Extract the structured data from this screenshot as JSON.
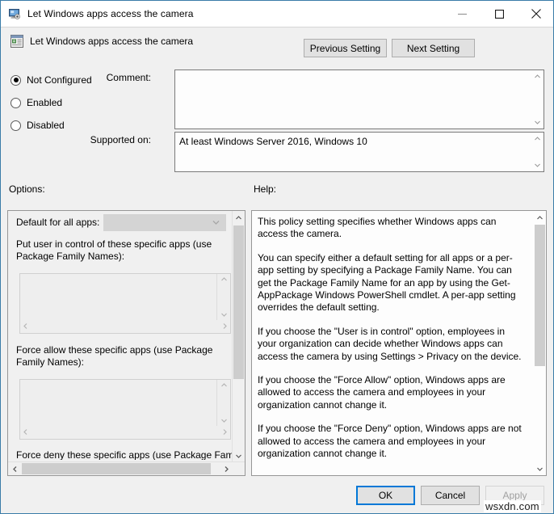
{
  "window": {
    "title": "Let Windows apps access the camera",
    "icon": "monitor-policy-icon",
    "controls": {
      "minimize": "minimize-icon",
      "maximize": "maximize-icon",
      "close": "close-icon"
    },
    "accent_color": "#3a7ca8"
  },
  "header": {
    "icon": "group-policy-setting-icon",
    "title": "Let Windows apps access the camera",
    "previous_button": "Previous Setting",
    "next_button": "Next Setting"
  },
  "state": {
    "options": [
      {
        "label": "Not Configured",
        "selected": true
      },
      {
        "label": "Enabled",
        "selected": false
      },
      {
        "label": "Disabled",
        "selected": false
      }
    ]
  },
  "comment": {
    "label": "Comment:",
    "value": "",
    "scroll_up_icon": "chevron-up-icon",
    "scroll_down_icon": "chevron-down-icon"
  },
  "supported_on": {
    "label": "Supported on:",
    "value": "At least Windows Server 2016, Windows 10",
    "scroll_up_icon": "chevron-up-icon",
    "scroll_down_icon": "chevron-down-icon"
  },
  "options_panel": {
    "label": "Options:",
    "default_for_all_apps": {
      "label": "Default for all apps:",
      "value": "",
      "disabled": true,
      "chevron_icon": "chevron-down-icon"
    },
    "lists": [
      {
        "label": "Put user in control of these specific apps (use Package Family Names):",
        "value": "",
        "disabled": true
      },
      {
        "label": "Force allow these specific apps (use Package Family Names):",
        "value": "",
        "disabled": true
      }
    ],
    "truncated_label": "Force deny these specific apps (use Package Family",
    "scrollbar": {
      "up_icon": "chevron-up-icon",
      "down_icon": "chevron-down-icon",
      "left_icon": "chevron-left-icon",
      "right_icon": "chevron-right-icon"
    }
  },
  "help_panel": {
    "label": "Help:",
    "paragraphs": [
      "This policy setting specifies whether Windows apps can access the camera.",
      "You can specify either a default setting for all apps or a per-app setting by specifying a Package Family Name. You can get the Package Family Name for an app by using the Get-AppPackage Windows PowerShell cmdlet. A per-app setting overrides the default setting.",
      "If you choose the \"User is in control\" option, employees in your organization can decide whether Windows apps can access the camera by using Settings > Privacy on the device.",
      "If you choose the \"Force Allow\" option, Windows apps are allowed to access the camera and employees in your organization cannot change it.",
      "If you choose the \"Force Deny\" option, Windows apps are not allowed to access the camera and employees in your organization cannot change it."
    ],
    "scroll_up_icon": "chevron-up-icon",
    "scroll_down_icon": "chevron-down-icon"
  },
  "footer": {
    "ok": "OK",
    "cancel": "Cancel",
    "apply": "Apply",
    "apply_disabled": true
  },
  "watermark": "wsxdn.com"
}
